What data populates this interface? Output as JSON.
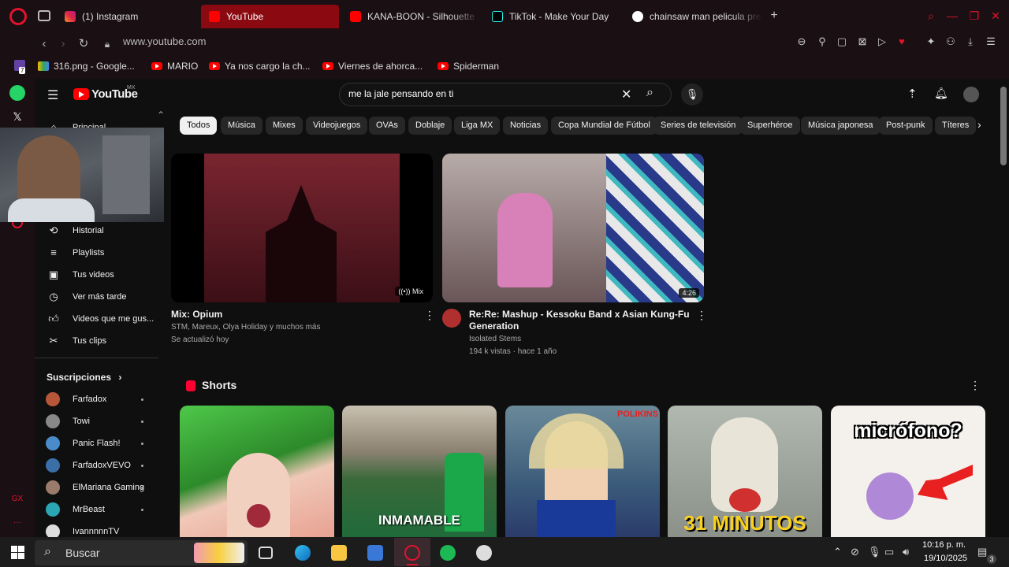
{
  "browser": {
    "tabs": [
      {
        "label": "(1) Instagram",
        "active": false
      },
      {
        "label": "YouTube",
        "active": true
      },
      {
        "label": "KANA-BOON - Silhouette",
        "active": false
      },
      {
        "label": "TikTok - Make Your Day",
        "active": false
      },
      {
        "label": "chainsaw man pelicula pre",
        "active": false
      }
    ],
    "new_tab": "+",
    "url": "www.youtube.com",
    "bookmarks": [
      {
        "label": "316.png - Google..."
      },
      {
        "label": "MARIO"
      },
      {
        "label": "Ya nos cargo la ch..."
      },
      {
        "label": "Viernes de ahorca..."
      },
      {
        "label": "Spiderman"
      }
    ],
    "bookmark_badge": "7"
  },
  "youtube": {
    "logo_text": "YouTube",
    "region": "MX",
    "search_query": "me la jale pensando en ti",
    "chips": [
      "Todos",
      "Música",
      "Mixes",
      "Videojuegos",
      "OVAs",
      "Doblaje",
      "Liga MX",
      "Noticias",
      "Copa Mundial de Fútbol",
      "Series de televisión",
      "Superhéroe",
      "Música japonesa",
      "Post-punk",
      "Títeres"
    ],
    "nav_top": "Principal",
    "nav": [
      "Historial",
      "Playlists",
      "Tus videos",
      "Ver más tarde",
      "Videos que me gus...",
      "Tus clips"
    ],
    "subs_title": "Suscripciones",
    "subs": [
      "Farfadox",
      "Towi",
      "Panic Flash!",
      "FarfadoxVEVO",
      "ElMariana Gaming",
      "MrBeast",
      "IvannnnnTV"
    ],
    "videos": [
      {
        "title": "Mix: Opium",
        "meta1": "STM, Mareux, Olya Holiday y muchos más",
        "meta2": "Se actualizó hoy",
        "badge": "Mix"
      },
      {
        "title_line1": "Re:Re: Mashup - Kessoku Band x Asian Kung-Fu",
        "title_line2": "Generation",
        "channel": "Isolated Stems",
        "meta2": "194 k vistas · hace 1 año",
        "duration": "4:26"
      }
    ],
    "shorts_title": "Shorts",
    "shorts": [
      {
        "overlay": ""
      },
      {
        "overlay": "INMAMABLE"
      },
      {
        "overlay": "POLIKINS"
      },
      {
        "overlay": "31 MINUTOS"
      },
      {
        "overlay": "micrófono?"
      }
    ]
  },
  "taskbar": {
    "search_placeholder": "Buscar",
    "time": "10:16 p. m.",
    "date": "19/10/2025",
    "notif_count": "3"
  }
}
